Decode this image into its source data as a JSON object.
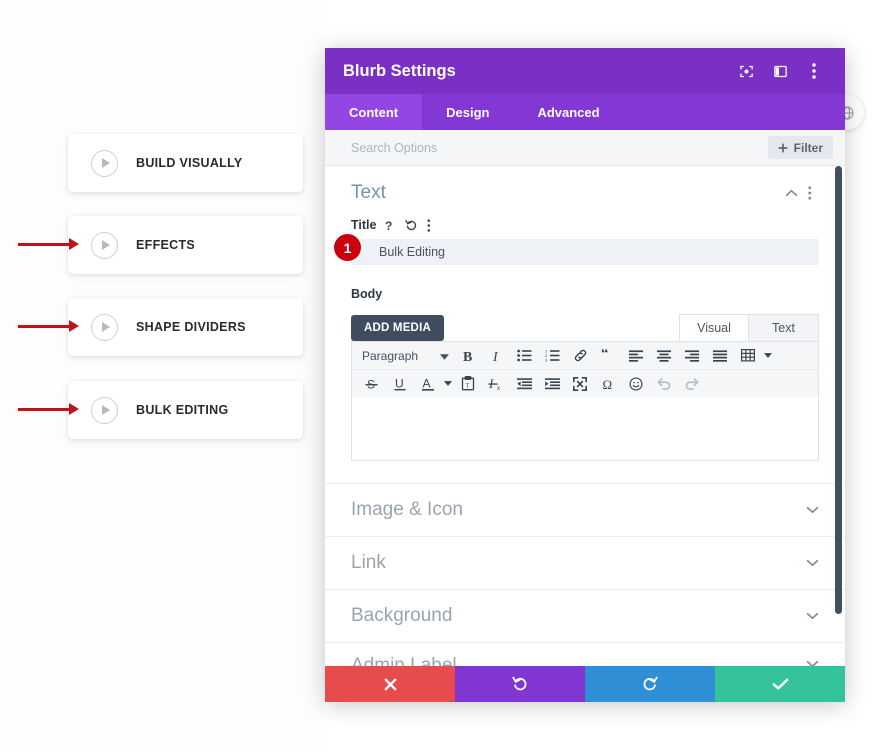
{
  "left_panel": {
    "items": [
      {
        "label": "BUILD VISUALLY",
        "has_arrow": false
      },
      {
        "label": "EFFECTS",
        "has_arrow": true
      },
      {
        "label": "SHAPE DIVIDERS",
        "has_arrow": true
      },
      {
        "label": "BULK EDITING",
        "has_arrow": true
      }
    ]
  },
  "globe_badge": {
    "icon": "globe-icon"
  },
  "modal": {
    "header": {
      "title": "Blurb Settings",
      "icons": [
        "focus-target-icon",
        "panel-layout-icon",
        "vertical-dots-icon"
      ]
    },
    "tabs": [
      {
        "label": "Content",
        "active": true
      },
      {
        "label": "Design",
        "active": false
      },
      {
        "label": "Advanced",
        "active": false
      }
    ],
    "search": {
      "placeholder": "Search Options",
      "filter_label": "Filter",
      "filter_icon": "plus-icon"
    },
    "text_section": {
      "title": "Text",
      "collapse_icon": "chevron-up-icon",
      "menu_icon": "vertical-dots-icon",
      "title_field": {
        "label": "Title",
        "help_icon": "question-mark-icon",
        "reset_icon": "undo-arrow-icon",
        "menu_icon": "vertical-dots-icon",
        "badge": "1",
        "value": "Bulk Editing",
        "placeholder": "Bulk Editing"
      },
      "body_field": {
        "label": "Body",
        "add_media_label": "ADD MEDIA",
        "editor_tabs": [
          {
            "label": "Visual",
            "active": true
          },
          {
            "label": "Text",
            "active": false
          }
        ],
        "format_select": "Paragraph",
        "toolbar_row1": [
          "bold-icon",
          "italic-icon",
          "bulleted-list-icon",
          "numbered-list-icon",
          "link-icon",
          "blockquote-icon",
          "align-left-icon",
          "align-center-icon",
          "align-right-icon",
          "align-justify-icon",
          "table-icon"
        ],
        "toolbar_row2": [
          "strikethrough-icon",
          "underline-icon",
          "text-color-icon",
          "paste-as-text-icon",
          "clear-formatting-icon",
          "outdent-icon",
          "indent-icon",
          "fullscreen-icon",
          "special-character-icon",
          "emoji-icon",
          "undo-icon",
          "redo-icon"
        ],
        "content": ""
      }
    },
    "accordions": [
      {
        "label": "Image & Icon",
        "icon": "chevron-down-icon",
        "partial": false
      },
      {
        "label": "Link",
        "icon": "chevron-down-icon",
        "partial": false
      },
      {
        "label": "Background",
        "icon": "chevron-down-icon",
        "partial": false
      },
      {
        "label": "Admin Label",
        "icon": "chevron-down-icon",
        "partial": true
      }
    ],
    "footer": [
      {
        "name": "cancel",
        "icon": "close-x-icon",
        "color": "#e74c4c"
      },
      {
        "name": "undo",
        "icon": "undo-arrow-icon",
        "color": "#8236d1"
      },
      {
        "name": "redo",
        "icon": "redo-arrow-icon",
        "color": "#2e8fd4"
      },
      {
        "name": "save",
        "icon": "checkmark-icon",
        "color": "#34c39a"
      }
    ]
  },
  "colors": {
    "header_purple": "#7a30c4",
    "tabs_purple": "#8338d6",
    "active_tab_purple": "#9346e4",
    "badge_red": "#c8000f",
    "arrow_red": "#c1121a",
    "section_title_blue": "#6f95b8"
  }
}
